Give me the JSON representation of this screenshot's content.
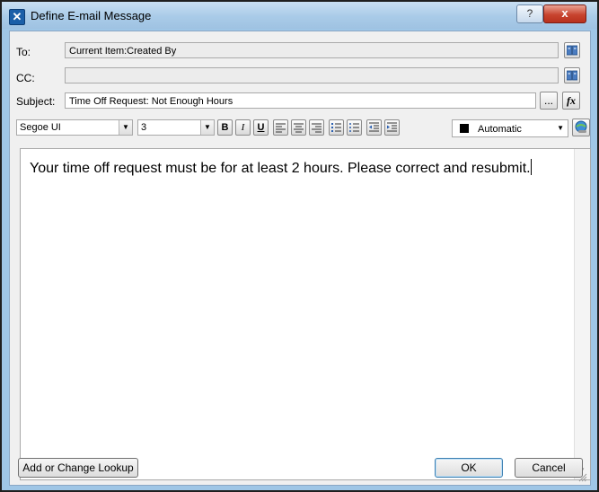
{
  "window": {
    "title": "Define E-mail Message",
    "help_glyph": "?",
    "close_glyph": "x"
  },
  "fields": {
    "to_label": "To:",
    "to_value": "Current Item:Created By",
    "cc_label": "CC:",
    "cc_value": "",
    "subject_label": "Subject:",
    "subject_value": "Time Off Request: Not Enough Hours",
    "ellipsis_label": "...",
    "fx_label": "fx"
  },
  "toolbar": {
    "font": "Segoe UI",
    "size": "3",
    "bold": "B",
    "italic": "I",
    "underline": "U",
    "color_label": "Automatic",
    "color_value": "#000000"
  },
  "body": {
    "text": "Your time off request must be for at least 2 hours. Please correct and resubmit."
  },
  "footer": {
    "lookup_label": "Add or Change Lookup",
    "ok_label": "OK",
    "cancel_label": "Cancel"
  }
}
